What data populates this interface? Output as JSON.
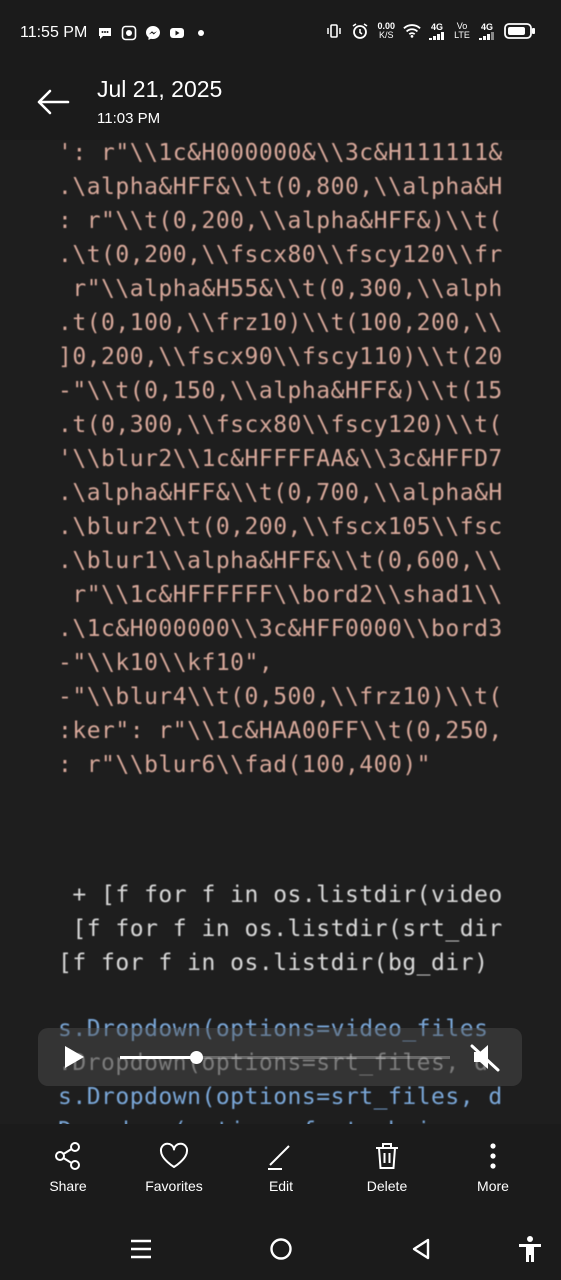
{
  "status_bar": {
    "time": "11:55 PM",
    "net_speed": "0.00",
    "net_unit": "K/S",
    "sim1": "4G",
    "volte": "Vo LTE",
    "sim2": "4G"
  },
  "header": {
    "date": "Jul 21, 2025",
    "time": "11:03 PM"
  },
  "media_text": [
    "': r\"\\\\1c&H000000&\\\\3c&H111111&",
    ".\\alpha&HFF&\\\\t(0,800,\\\\alpha&H",
    ": r\"\\\\t(0,200,\\\\alpha&HFF&)\\\\t(",
    ".\\t(0,200,\\\\fscx80\\\\fscy120\\\\fr",
    " r\"\\\\alpha&H55&\\\\t(0,300,\\\\alph",
    ".t(0,100,\\\\frz10)\\\\t(100,200,\\\\",
    "]0,200,\\\\fscx90\\\\fscy110)\\\\t(20",
    "-\"\\\\t(0,150,\\\\alpha&HFF&)\\\\t(15",
    ".t(0,300,\\\\fscx80\\\\fscy120)\\\\t(",
    "'\\\\blur2\\\\1c&HFFFFAA&\\\\3c&HFFD7",
    ".\\alpha&HFF&\\\\t(0,700,\\\\alpha&H",
    ".\\blur2\\\\t(0,200,\\\\fscx105\\\\fsc",
    ".\\blur1\\\\alpha&HFF&\\\\t(0,600,\\\\",
    " r\"\\\\1c&HFFFFFF\\\\bord2\\\\shad1\\\\",
    ".\\1c&H000000\\\\3c&HFF0000\\\\bord3",
    "-\"\\\\k10\\\\kf10\",",
    "-\"\\\\blur4\\\\t(0,500,\\\\frz10)\\\\t(",
    ":ker\": r\"\\\\1c&HAA00FF\\\\t(0,250,",
    ": r\"\\\\blur6\\\\fad(100,400)\"",
    " + [f for f in os.listdir(video",
    " [f for f in os.listdir(srt_dir",
    "[f for f in os.listdir(bg_dir)",
    "s.Dropdown(options=video_files",
    ".Dropdown(options=srt_files, d",
    "s.Dropdown(options=srt_files, d",
    "Dropdown(options=font_choices"
  ],
  "player": {
    "progress": 0.23
  },
  "actions": [
    {
      "label": "Share",
      "icon": "share-icon"
    },
    {
      "label": "Favorites",
      "icon": "heart-icon"
    },
    {
      "label": "Edit",
      "icon": "edit-icon"
    },
    {
      "label": "Delete",
      "icon": "trash-icon"
    },
    {
      "label": "More",
      "icon": "more-vertical-icon"
    }
  ],
  "colors": {
    "background": "#1a1a1a",
    "code_red": "#d7a89a",
    "code_keyword": "#b78bcf",
    "code_blue": "#7aa7d8"
  }
}
